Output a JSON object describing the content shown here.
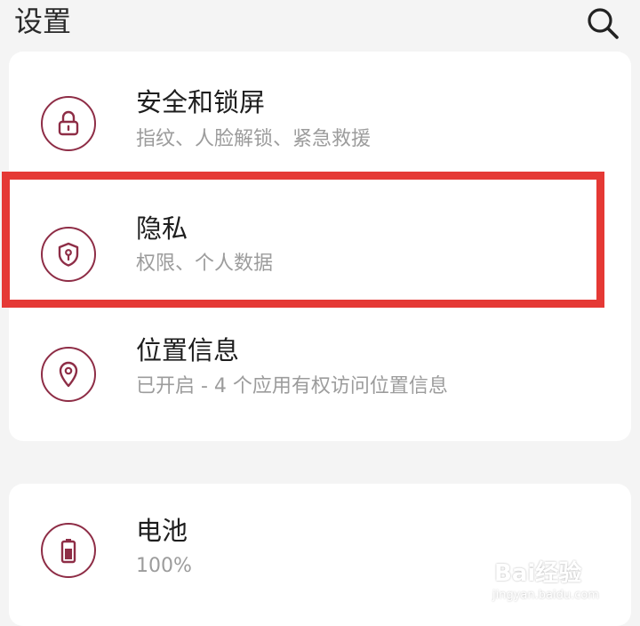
{
  "header": {
    "title": "设置",
    "search_icon": "search-icon"
  },
  "accent_color": "#8e2d46",
  "highlight_color": "#e53935",
  "items": [
    {
      "key": "security",
      "label": "安全和锁屏",
      "sublabel": "指纹、人脸解锁、紧急救援",
      "icon": "lock-icon"
    },
    {
      "key": "privacy",
      "label": "隐私",
      "sublabel": "权限、个人数据",
      "icon": "shield-key-icon",
      "highlighted": true
    },
    {
      "key": "location",
      "label": "位置信息",
      "sublabel": "已开启 - 4 个应用有权访问位置信息",
      "icon": "location-pin-icon"
    },
    {
      "key": "battery",
      "label": "电池",
      "sublabel": "100%",
      "icon": "battery-icon"
    }
  ],
  "watermark": {
    "brand": "Bai经验",
    "url": "jingyan.baidu.com"
  }
}
